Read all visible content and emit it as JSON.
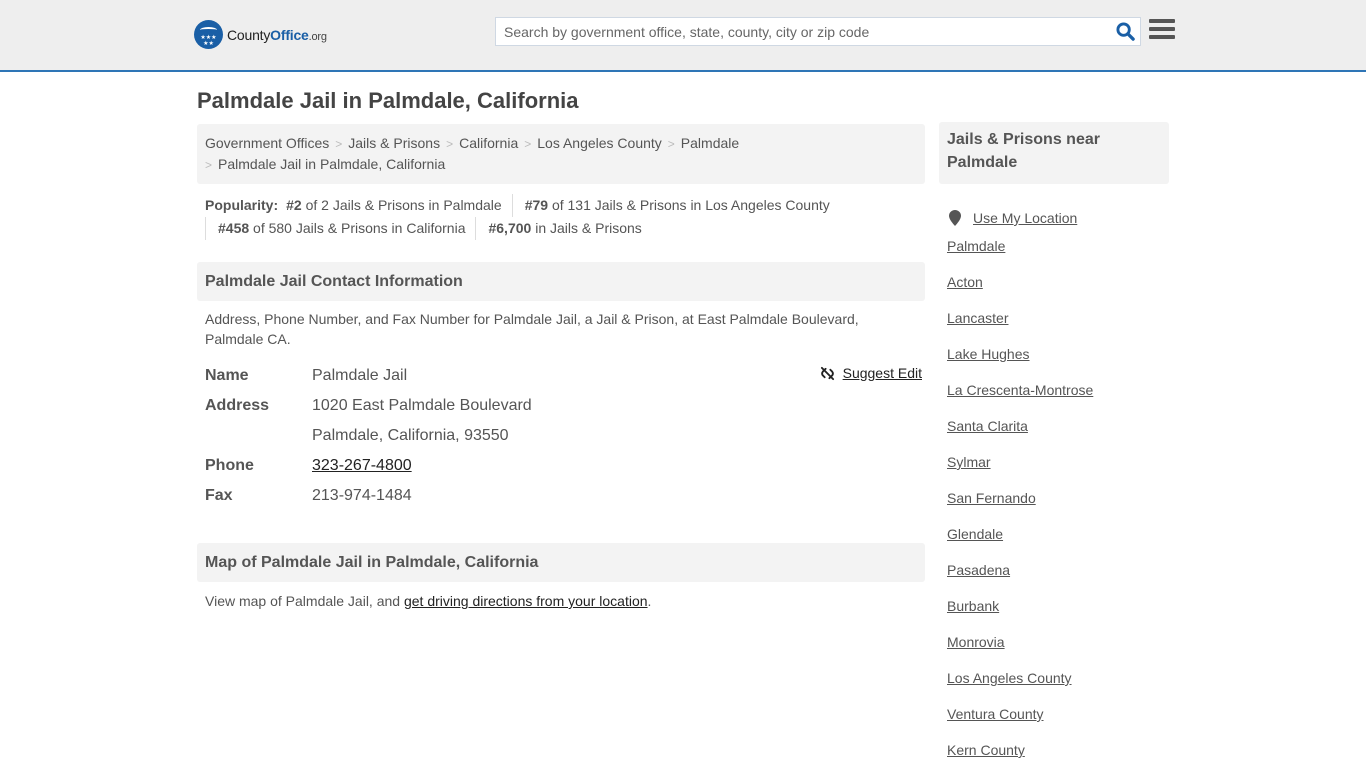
{
  "header": {
    "logo": {
      "part1": "County",
      "part2": "Office",
      "part3": ".org"
    },
    "search_placeholder": "Search by government office, state, county, city or zip code",
    "search_value": ""
  },
  "page_title": "Palmdale Jail in Palmdale, California",
  "breadcrumb": [
    "Government Offices",
    "Jails & Prisons",
    "California",
    "Los Angeles County",
    "Palmdale",
    "Palmdale Jail in Palmdale, California"
  ],
  "popularity": {
    "label": "Popularity:",
    "items": [
      {
        "rank": "#2",
        "text": "of 2 Jails & Prisons in Palmdale"
      },
      {
        "rank": "#79",
        "text": "of 131 Jails & Prisons in Los Angeles County"
      },
      {
        "rank": "#458",
        "text": "of 580 Jails & Prisons in California"
      },
      {
        "rank": "#6,700",
        "text": "in Jails & Prisons"
      }
    ]
  },
  "contact": {
    "header": "Palmdale Jail Contact Information",
    "description": "Address, Phone Number, and Fax Number for Palmdale Jail, a Jail & Prison, at East Palmdale Boulevard, Palmdale CA.",
    "suggest_edit": "Suggest Edit",
    "rows": {
      "name_label": "Name",
      "name_value": "Palmdale Jail",
      "address_label": "Address",
      "address_line1": "1020 East Palmdale Boulevard",
      "address_line2": "Palmdale, California, 93550",
      "phone_label": "Phone",
      "phone_value": "323-267-4800",
      "fax_label": "Fax",
      "fax_value": "213-974-1484"
    }
  },
  "map": {
    "header": "Map of Palmdale Jail in Palmdale, California",
    "desc_prefix": "View map of Palmdale Jail, and ",
    "desc_link": "get driving directions from your location",
    "desc_suffix": "."
  },
  "sidebar": {
    "header": "Jails & Prisons near Palmdale",
    "use_location": "Use My Location",
    "links": [
      "Palmdale",
      "Acton",
      "Lancaster",
      "Lake Hughes",
      "La Crescenta-Montrose",
      "Santa Clarita",
      "Sylmar",
      "San Fernando",
      "Glendale",
      "Pasadena",
      "Burbank",
      "Monrovia",
      "Los Angeles County",
      "Ventura County",
      "Kern County"
    ]
  },
  "colors": {
    "brand_blue": "#1a5fa6",
    "header_border": "#2e75b6",
    "panel_bg": "#f3f3f3"
  }
}
